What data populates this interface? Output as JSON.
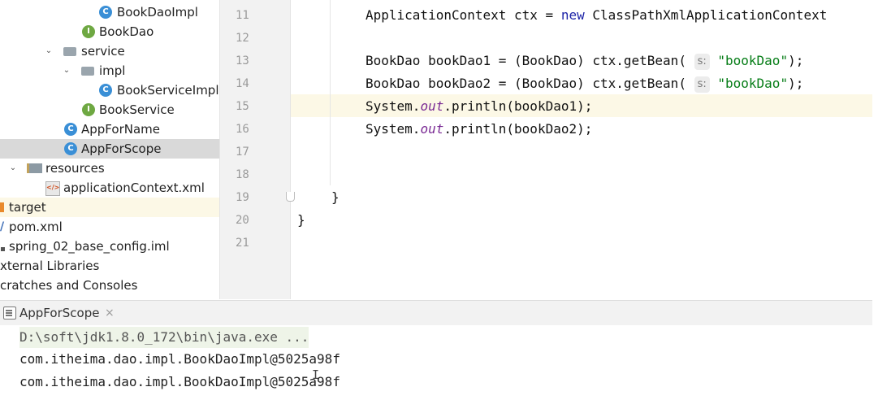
{
  "project_tree": [
    {
      "label": "BookDaoImpl",
      "icon": "class-icon"
    },
    {
      "label": "BookDao",
      "icon": "interface-icon"
    },
    {
      "label": "service",
      "icon": "folder-icon",
      "arrow": "expanded"
    },
    {
      "label": "impl",
      "icon": "folder-icon",
      "arrow": "expanded"
    },
    {
      "label": "BookServiceImpl",
      "icon": "class-icon"
    },
    {
      "label": "BookService",
      "icon": "interface-icon"
    },
    {
      "label": "AppForName",
      "icon": "runnable-class-icon"
    },
    {
      "label": "AppForScope",
      "icon": "runnable-class-icon",
      "selected": true
    },
    {
      "label": "resources",
      "icon": "resources-folder-icon",
      "arrow": "expanded"
    },
    {
      "label": "applicationContext.xml",
      "icon": "xml-file-icon"
    },
    {
      "label": "target",
      "icon": "target-folder-icon"
    },
    {
      "label": "pom.xml",
      "icon": "maven-icon"
    },
    {
      "label": "spring_02_base_config.iml",
      "icon": "iml-file-icon"
    },
    {
      "label": "xternal Libraries"
    },
    {
      "label": "cratches and Consoles"
    }
  ],
  "editor": {
    "line_numbers": [
      "11",
      "12",
      "13",
      "14",
      "15",
      "16",
      "17",
      "18",
      "19",
      "20",
      "21"
    ],
    "code": {
      "line11": {
        "type": "ApplicationContext ctx = ",
        "kw": "new",
        "rest": " ClassPathXmlApplicationContext"
      },
      "line13": {
        "pre": "BookDao bookDao1 = (BookDao) ctx.getBean( ",
        "hint": "s:",
        "str": "\"bookDao\"",
        "post": ");"
      },
      "line14": {
        "pre": "BookDao bookDao2 = (BookDao) ctx.getBean( ",
        "hint": "s:",
        "str": "\"bookDao\"",
        "post": ");"
      },
      "line15": {
        "pre": "System.",
        "field": "out",
        "post": ".println(bookDao1);"
      },
      "line16": {
        "pre": "System.",
        "field": "out",
        "post": ".println(bookDao2);"
      },
      "line19": "}",
      "line20": "}"
    }
  },
  "run_panel": {
    "tab_label": "AppForScope",
    "tab_close": "×",
    "console": [
      "D:\\soft\\jdk1.8.0_172\\bin\\java.exe ...",
      "com.itheima.dao.impl.BookDaoImpl@5025a98f",
      "com.itheima.dao.impl.BookDaoImpl@5025a98f"
    ]
  },
  "colors": {
    "keyword": "#1d24a8",
    "string": "#067d17",
    "static_field": "#7a2a94",
    "current_line": "#fcf8e6",
    "selection": "#d9d9d9",
    "gutter": "#f2f2f2"
  }
}
